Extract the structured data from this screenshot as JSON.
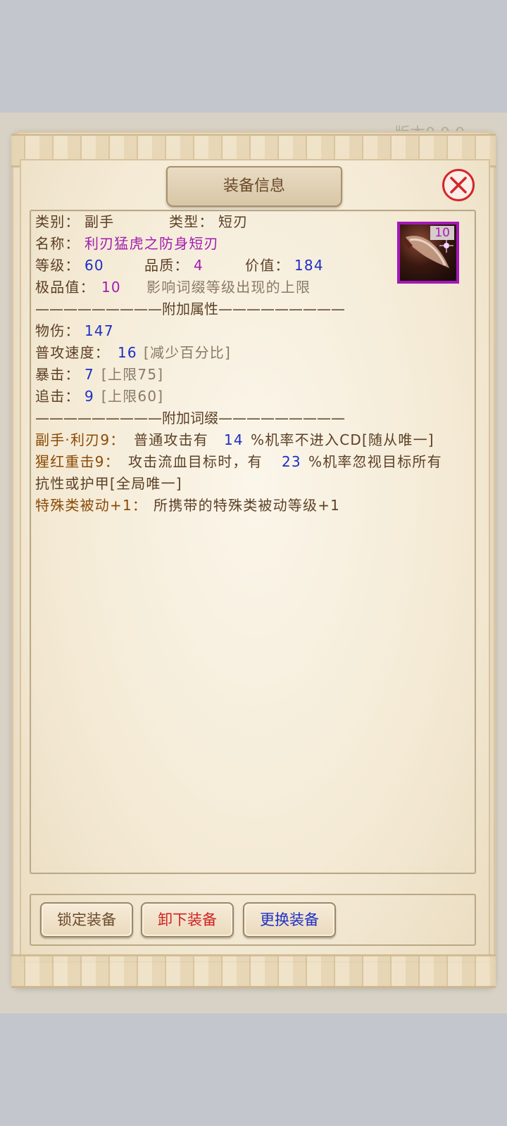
{
  "background": {
    "top_right_text": "版本0.0.0"
  },
  "dialog": {
    "title": "装备信息"
  },
  "item": {
    "category_label": "类别：",
    "category": "副手",
    "type_label": "类型：",
    "type": "短刃",
    "name_label": "名称：",
    "name": "利刃猛虎之防身短刃",
    "level_label": "等级：",
    "level": "60",
    "quality_label": "品质：",
    "quality": "4",
    "value_label": "价值：",
    "value": "184",
    "excellence_label": "极品值：",
    "excellence": "10",
    "excellence_note": "影响词缀等级出现的上限",
    "icon_count": "10",
    "icon": "dagger-icon"
  },
  "attributes": {
    "divider": "—————————附加属性—————————",
    "phys_label": "物伤：",
    "phys": "147",
    "speed_label": "普攻速度：",
    "speed": "16",
    "speed_note": "[减少百分比]",
    "crit_label": "暴击：",
    "crit": "7",
    "crit_note": "[上限75]",
    "pursuit_label": "追击：",
    "pursuit": "9",
    "pursuit_note": "[上限60]"
  },
  "affixes": {
    "divider": "—————————附加词缀—————————",
    "a1_name": "副手·利刃9：",
    "a1_pre": "普通攻击有",
    "a1_val": "14",
    "a1_post": "%机率不进入CD[随从唯一]",
    "a2_name": "猩红重击9：",
    "a2_pre": "攻击流血目标时，有",
    "a2_val": "23",
    "a2_post": "%机率忽视目标所有",
    "a2_line2": "抗性或护甲[全局唯一]",
    "a3_name": "特殊类被动+1：",
    "a3_text": "所携带的特殊类被动等级+1"
  },
  "buttons": {
    "lock": "锁定装备",
    "unload": "卸下装备",
    "swap": "更换装备"
  },
  "colors": {
    "blue_value": "#1d2fc6",
    "purple_value": "#a21cb0",
    "affix_gold": "#8a4a06",
    "unload_red": "#d12020",
    "close_red": "#d4252a"
  }
}
